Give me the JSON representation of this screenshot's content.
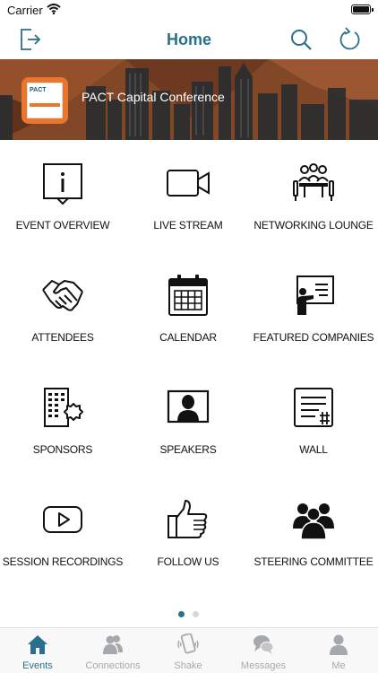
{
  "status": {
    "carrier": "Carrier"
  },
  "nav": {
    "title": "Home",
    "logout_icon": "logout-icon",
    "search_icon": "search-icon",
    "refresh_icon": "refresh-icon"
  },
  "banner": {
    "title": "PACT Capital Conference",
    "logo_text": "PACT"
  },
  "tiles": [
    {
      "label": "EVENT OVERVIEW",
      "icon": "info-icon"
    },
    {
      "label": "LIVE STREAM",
      "icon": "video-camera-icon"
    },
    {
      "label": "NETWORKING LOUNGE",
      "icon": "meeting-table-icon"
    },
    {
      "label": "ATTENDEES",
      "icon": "handshake-icon"
    },
    {
      "label": "CALENDAR",
      "icon": "calendar-icon"
    },
    {
      "label": "FEATURED COMPANIES",
      "icon": "presentation-icon"
    },
    {
      "label": "SPONSORS",
      "icon": "building-badge-icon"
    },
    {
      "label": "SPEAKERS",
      "icon": "speaker-portrait-icon"
    },
    {
      "label": "WALL",
      "icon": "wall-hashtag-icon"
    },
    {
      "label": "SESSION RECORDINGS",
      "icon": "play-icon"
    },
    {
      "label": "FOLLOW US",
      "icon": "thumbs-up-icon"
    },
    {
      "label": "STEERING COMMITTEE",
      "icon": "group-icon"
    }
  ],
  "pager": {
    "pages": 2,
    "current": 1
  },
  "tabs": [
    {
      "label": "Events",
      "icon": "home-icon",
      "active": true
    },
    {
      "label": "Connections",
      "icon": "connections-icon",
      "active": false
    },
    {
      "label": "Shake",
      "icon": "shake-phone-icon",
      "active": false
    },
    {
      "label": "Messages",
      "icon": "messages-icon",
      "active": false
    },
    {
      "label": "Me",
      "icon": "person-icon",
      "active": false
    }
  ],
  "colors": {
    "accent": "#2a6f8c",
    "banner_orange": "#e8762d",
    "inactive_tab": "#a5a8ad"
  }
}
